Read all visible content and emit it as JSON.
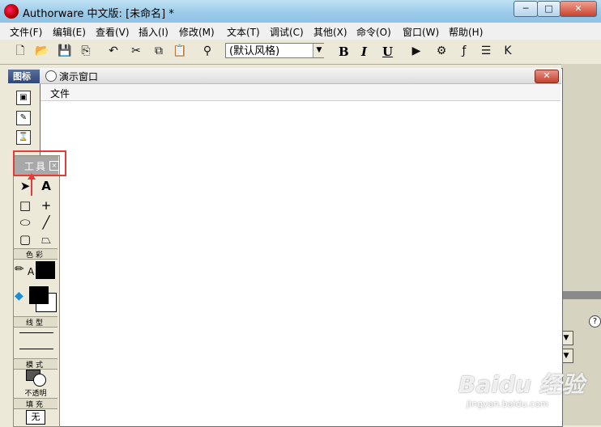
{
  "window": {
    "title": "Authorware 中文版: [未命名] *",
    "minimize": "─",
    "maximize": "□",
    "close": "✕"
  },
  "menubar": {
    "items": [
      "文件(F)",
      "编辑(E)",
      "查看(V)",
      "插入(I)",
      "修改(M)",
      "文本(T)",
      "调试(C)",
      "其他(X)",
      "命令(O)",
      "窗口(W)",
      "帮助(H)"
    ]
  },
  "toolbar": {
    "style_select": "(默认风格)",
    "bold": "B",
    "italic": "I",
    "underline": "U",
    "icons": [
      "new-icon",
      "open-icon",
      "save-all-icon",
      "import-icon",
      "undo-icon",
      "cut-icon",
      "copy-icon",
      "paste-icon",
      "find-icon",
      "run-icon",
      "control-panel-icon",
      "functions-icon",
      "variables-icon",
      "knowledge-objects-icon"
    ]
  },
  "icon_palette": {
    "title": "图标"
  },
  "presentation_window": {
    "title": "演示窗口",
    "menu": [
      "文件"
    ]
  },
  "tools_panel": {
    "title": "工具",
    "sections": {
      "color": "色彩",
      "line": "线型",
      "mode": "模式",
      "fill": "填充"
    },
    "mode_value": "不透明",
    "fill_value": "无",
    "tools": [
      "pointer-tool",
      "text-tool",
      "rectangle-tool",
      "line-tool",
      "oval-tool",
      "diagonal-line-tool",
      "rounded-rectangle-tool",
      "polygon-tool"
    ],
    "colors": {
      "line_color": "#000000",
      "fill_fg": "#000000",
      "fill_bg": "#ffffff",
      "highlight": "#e53b3b"
    }
  },
  "watermark": {
    "text": "Baidu 经验",
    "sub": "jingyan.baidu.com"
  }
}
